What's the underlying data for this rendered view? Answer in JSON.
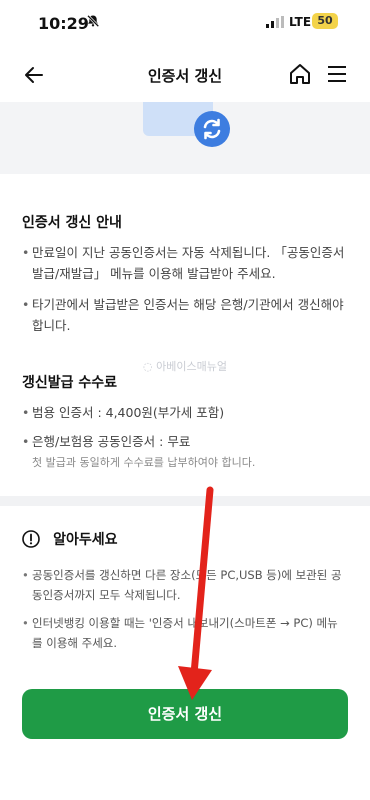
{
  "status_bar": {
    "time": "10:29",
    "network": "LTE",
    "battery": "50"
  },
  "header": {
    "title": "인증서 갱신"
  },
  "renewal_info": {
    "heading": "인증서 갱신 안내",
    "items": [
      "만료일이 지난 공동인증서는 자동 삭제됩니다. 「공동인증서 발급/재발급」 메뉴를 이용해 발급받아 주세요.",
      "타기관에서 발급받은 인증서는 해당 은행/기관에서 갱신해야 합니다."
    ]
  },
  "fees": {
    "heading": "갱신발급 수수료",
    "items": [
      "범용 인증서 : 4,400원(부가세 포함)",
      "은행/보험용 공동인증서 : 무료"
    ],
    "note": "첫 발급과 동일하게 수수료를 납부하여야 합니다."
  },
  "watermark": "아베이스매뉴얼",
  "notice": {
    "heading": "알아두세요",
    "items": [
      "공동인증서를 갱신하면 다른 장소(모든 PC,USB 등)에 보관된 공동인증서까지 모두 삭제됩니다.",
      "인터넷뱅킹 이용할 때는 '인증서 내보내기(스마트폰 → PC) 메뉴를 이용해 주세요."
    ]
  },
  "action": {
    "renew_label": "인증서 갱신"
  },
  "colors": {
    "accent_green": "#1f9b46",
    "annotation_red": "#e3231b",
    "refresh_blue": "#3d7de0"
  },
  "icons": [
    "back-arrow-icon",
    "home-icon",
    "hamburger-menu-icon",
    "refresh-icon",
    "exclamation-circle-icon",
    "do-not-disturb-bell-icon"
  ]
}
